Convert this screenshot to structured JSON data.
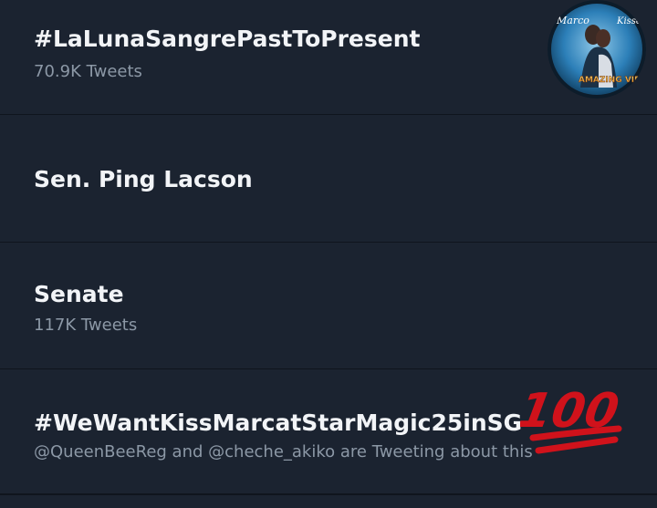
{
  "trends": [
    {
      "title": "#LaLunaSangrePastToPresent",
      "meta": "70.9K Tweets",
      "thumbnail": {
        "text_top_left": "Marco",
        "text_top_right": "Kisses",
        "text_bottom": "AMAZING VIRG"
      }
    },
    {
      "title": "Sen. Ping Lacson",
      "meta": ""
    },
    {
      "title": "Senate",
      "meta": "117K Tweets"
    },
    {
      "title": "#WeWantKissMarcatStarMagic25inSG",
      "meta": "@QueenBeeReg and @cheche_akiko are Tweeting about this"
    }
  ],
  "overlay": {
    "emoji_100": "100"
  },
  "colors": {
    "background": "#1b2330",
    "divider": "#0f151d",
    "title": "#f2f4f7",
    "meta": "#8c98a6",
    "emoji_red": "#d0121b"
  }
}
